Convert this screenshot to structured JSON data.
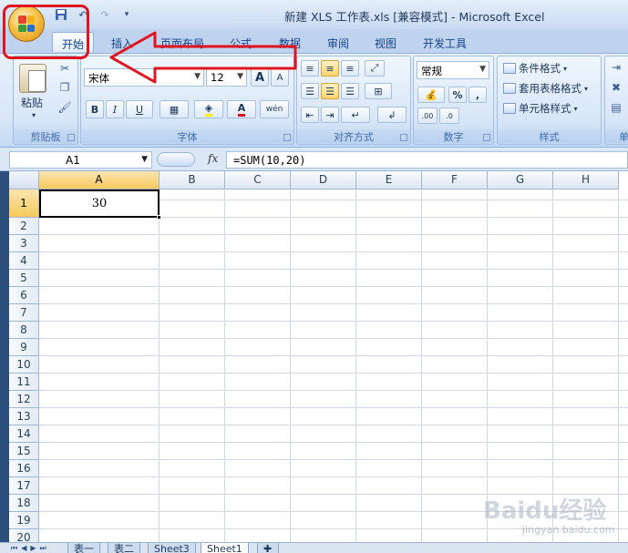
{
  "window": {
    "title": "新建 XLS 工作表.xls  [兼容模式] - Microsoft Excel"
  },
  "tabs": [
    "开始",
    "插入",
    "页面布局",
    "公式",
    "数据",
    "审阅",
    "视图",
    "开发工具"
  ],
  "ribbon": {
    "clipboard": {
      "label": "剪贴板",
      "paste": "粘贴"
    },
    "font": {
      "label": "字体",
      "name": "宋体",
      "size": "12",
      "grow": "A",
      "shrink": "A",
      "bold": "B",
      "italic": "I",
      "underline": "U",
      "font_color_glyph": "A",
      "phonetic": "wén"
    },
    "alignment": {
      "label": "对齐方式"
    },
    "number": {
      "label": "数字",
      "format": "常规",
      "percent": "%",
      "comma": ",",
      "inc_decimal": ".00",
      "dec_decimal": ".0"
    },
    "styles": {
      "label": "样式",
      "conditional": "条件格式",
      "table": "套用表格格式",
      "cell": "单元格样式"
    },
    "cells": {
      "label": "单"
    }
  },
  "formula_bar": {
    "cell_ref": "A1",
    "fx": "fx",
    "formula": "=SUM(10,20)"
  },
  "grid": {
    "columns": [
      "A",
      "B",
      "C",
      "D",
      "E",
      "F",
      "G",
      "H"
    ],
    "rows": [
      "1",
      "2",
      "3",
      "4",
      "5",
      "6",
      "7",
      "8",
      "9",
      "10",
      "11",
      "12",
      "13",
      "14",
      "15",
      "16",
      "17",
      "18",
      "19",
      "20"
    ],
    "a1_value": "30"
  },
  "sheets": [
    "表一",
    "表二",
    "Sheet3",
    "Sheet1"
  ],
  "watermark": {
    "brand": "Baidu经验",
    "url": "jingyan.baidu.com"
  },
  "colors": {
    "annotation_red": "#e0141e"
  }
}
